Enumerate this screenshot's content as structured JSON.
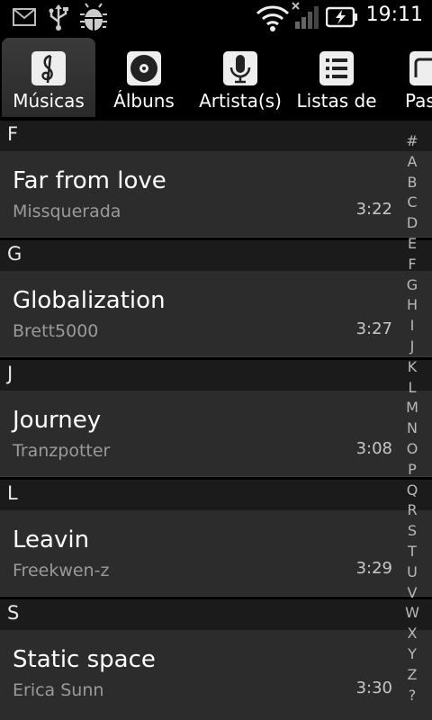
{
  "status_bar": {
    "time": "19:11",
    "icons": [
      "gmail-icon",
      "usb-icon",
      "android-debug-icon",
      "wifi-icon",
      "signal-icon",
      "battery-charging-icon"
    ]
  },
  "tabs": [
    {
      "label": "Músicas",
      "icon": "music-note-icon",
      "selected": true
    },
    {
      "label": "Álbuns",
      "icon": "disc-icon",
      "selected": false
    },
    {
      "label": "Artista(s)",
      "icon": "microphone-icon",
      "selected": false
    },
    {
      "label": "Listas de",
      "icon": "playlist-icon",
      "selected": false
    },
    {
      "label": "Pas",
      "icon": "folder-icon",
      "selected": false
    }
  ],
  "sections": [
    {
      "letter": "F",
      "songs": [
        {
          "title": "Far from love",
          "artist": "Missquerada",
          "duration": "3:22"
        }
      ]
    },
    {
      "letter": "G",
      "songs": [
        {
          "title": "Globalization",
          "artist": "Brett5000",
          "duration": "3:27"
        }
      ]
    },
    {
      "letter": "J",
      "songs": [
        {
          "title": "Journey",
          "artist": "Tranzpotter",
          "duration": "3:08"
        }
      ]
    },
    {
      "letter": "L",
      "songs": [
        {
          "title": "Leavin",
          "artist": "Freekwen-z",
          "duration": "3:29"
        }
      ]
    },
    {
      "letter": "S",
      "songs": [
        {
          "title": "Static space",
          "artist": "Erica Sunn",
          "duration": "3:30"
        }
      ]
    }
  ],
  "alphabet_index": [
    "#",
    "A",
    "B",
    "C",
    "D",
    "E",
    "F",
    "G",
    "H",
    "I",
    "J",
    "K",
    "L",
    "M",
    "N",
    "O",
    "P",
    "Q",
    "R",
    "S",
    "T",
    "U",
    "V",
    "W",
    "X",
    "Y",
    "Z",
    "?"
  ]
}
